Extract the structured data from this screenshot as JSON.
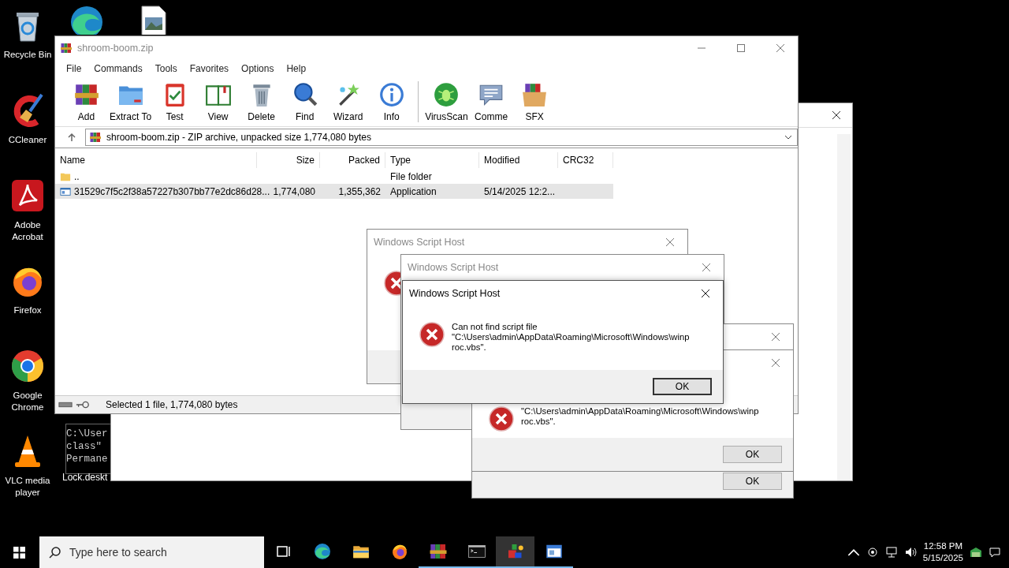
{
  "desktop": {
    "icons": [
      {
        "kind": "recycle",
        "label": "Recycle Bin"
      },
      {
        "kind": "cleaner",
        "label": "CCleaner"
      },
      {
        "kind": "acrobat",
        "label": "Adobe Acrobat"
      },
      {
        "kind": "firefox",
        "label": "Firefox"
      },
      {
        "kind": "chrome",
        "label": "Google Chrome"
      },
      {
        "kind": "vlc",
        "label": "VLC media player"
      }
    ],
    "top_icons": [
      {
        "kind": "edge"
      },
      {
        "kind": "image"
      }
    ],
    "console_lines": [
      "C:\\User",
      "class\"",
      "Permane"
    ],
    "file_label": "Lock.deskt"
  },
  "winrar": {
    "title": "shroom-boom.zip",
    "active": false,
    "menu": [
      "File",
      "Commands",
      "Tools",
      "Favorites",
      "Options",
      "Help"
    ],
    "toolbar": [
      {
        "kind": "add",
        "label": "Add"
      },
      {
        "kind": "extract",
        "label": "Extract To"
      },
      {
        "kind": "test",
        "label": "Test"
      },
      {
        "kind": "view",
        "label": "View"
      },
      {
        "kind": "delete",
        "label": "Delete"
      },
      {
        "kind": "find",
        "label": "Find"
      },
      {
        "kind": "wizard",
        "label": "Wizard"
      },
      {
        "kind": "info",
        "label": "Info"
      },
      {
        "kind": "separator"
      },
      {
        "kind": "virusscan",
        "label": "VirusScan"
      },
      {
        "kind": "comment",
        "label": "Comme"
      },
      {
        "kind": "sfx",
        "label": "SFX"
      }
    ],
    "address": "shroom-boom.zip - ZIP archive, unpacked size 1,774,080 bytes",
    "columns": [
      "Name",
      "Size",
      "Packed",
      "Type",
      "Modified",
      "CRC32"
    ],
    "rows": [
      {
        "kind": "folder",
        "selected": false,
        "name": "..",
        "type": "File folder"
      },
      {
        "kind": "app",
        "selected": true,
        "name": "31529c7f5c2f38a57227b307bb77e2dc86d28...",
        "size": "1,774,080",
        "packed": "1,355,362",
        "type": "Application",
        "modified": "5/14/2025 12:2..."
      }
    ],
    "status": "Selected 1 file, 1,774,080 bytes"
  },
  "dialogs": [
    {
      "title": "Windows Script Host",
      "active": false,
      "kind": "error"
    },
    {
      "title": "Windows Script Host",
      "active": false
    },
    {
      "active": false,
      "button": "OK"
    },
    {
      "active": false,
      "kind": "error",
      "lines": [
        "\"C:\\Users\\admin\\AppData\\Roaming\\Microsoft\\Windows\\winp",
        "roc.vbs\"."
      ],
      "button": "OK"
    },
    {
      "title": "Windows Script Host",
      "active": true,
      "kind": "error",
      "lines": [
        "Can not find script file",
        "\"C:\\Users\\admin\\AppData\\Roaming\\Microsoft\\Windows\\winp",
        "roc.vbs\"."
      ],
      "button": "OK"
    }
  ],
  "taskbar": {
    "search_placeholder": "Type here to search",
    "apps": [
      {
        "kind": "edge",
        "running": false,
        "selected": false
      },
      {
        "kind": "explorer",
        "running": false,
        "selected": false
      },
      {
        "kind": "firefox",
        "running": false,
        "selected": false
      },
      {
        "kind": "winrar",
        "running": true,
        "selected": false
      },
      {
        "kind": "cmd",
        "running": true,
        "selected": false
      },
      {
        "kind": "blocks",
        "running": true,
        "selected": true
      },
      {
        "kind": "window",
        "running": true,
        "selected": false
      }
    ],
    "time": "12:58 PM",
    "date": "5/15/2025"
  }
}
